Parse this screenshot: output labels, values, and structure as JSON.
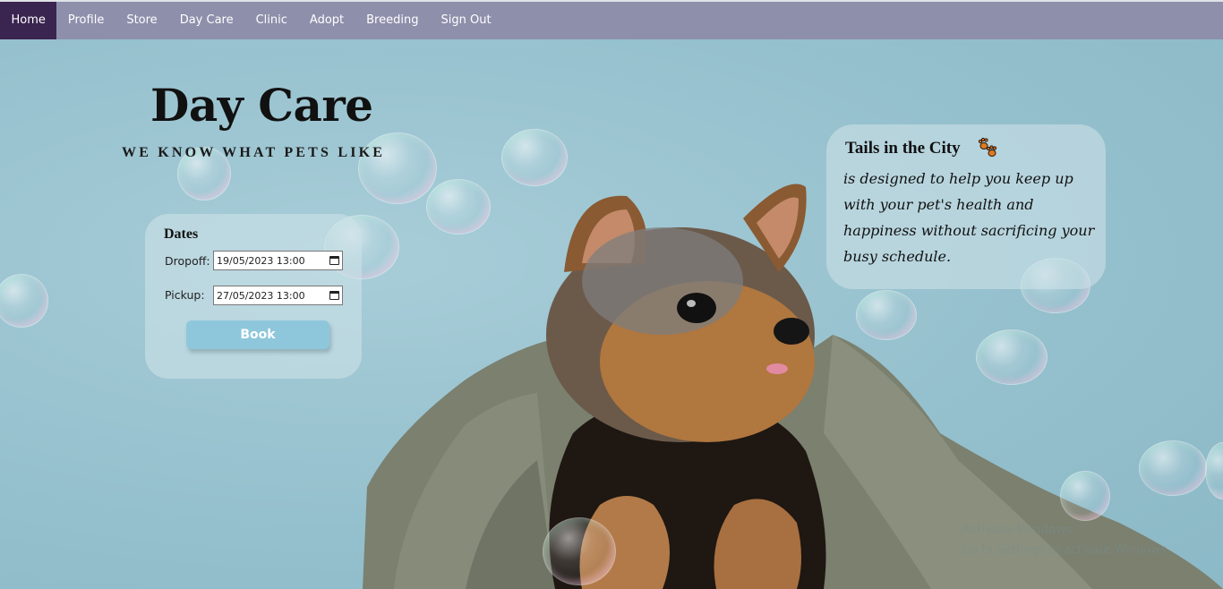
{
  "nav": {
    "items": [
      {
        "label": "Home",
        "active": true
      },
      {
        "label": "Profile"
      },
      {
        "label": "Store"
      },
      {
        "label": "Day Care"
      },
      {
        "label": "Clinic"
      },
      {
        "label": "Adopt"
      },
      {
        "label": "Breeding"
      },
      {
        "label": "Sign Out"
      }
    ]
  },
  "hero": {
    "title": "Day Care",
    "subtitle": "WE KNOW WHAT PETS LIKE"
  },
  "booking": {
    "heading": "Dates",
    "dropoff_label": "Dropoff:",
    "dropoff_value": "19/05/2023 13:00",
    "pickup_label": "Pickup:",
    "pickup_value": "27/05/2023 13:00",
    "book_label": "Book"
  },
  "info": {
    "heading": "Tails in the City",
    "paw_icon": "paw-icon",
    "text": "is designed to help you keep up with your pet's health and happiness without sacrificing your busy schedule."
  },
  "watermark": {
    "line1": "Activate Windows",
    "line2": "Go to Settings to activate Windows."
  },
  "colors": {
    "nav_bg": "#8e8fab",
    "nav_active": "#3a2450",
    "background": "#96c1ce",
    "button": "#8ec7db"
  }
}
